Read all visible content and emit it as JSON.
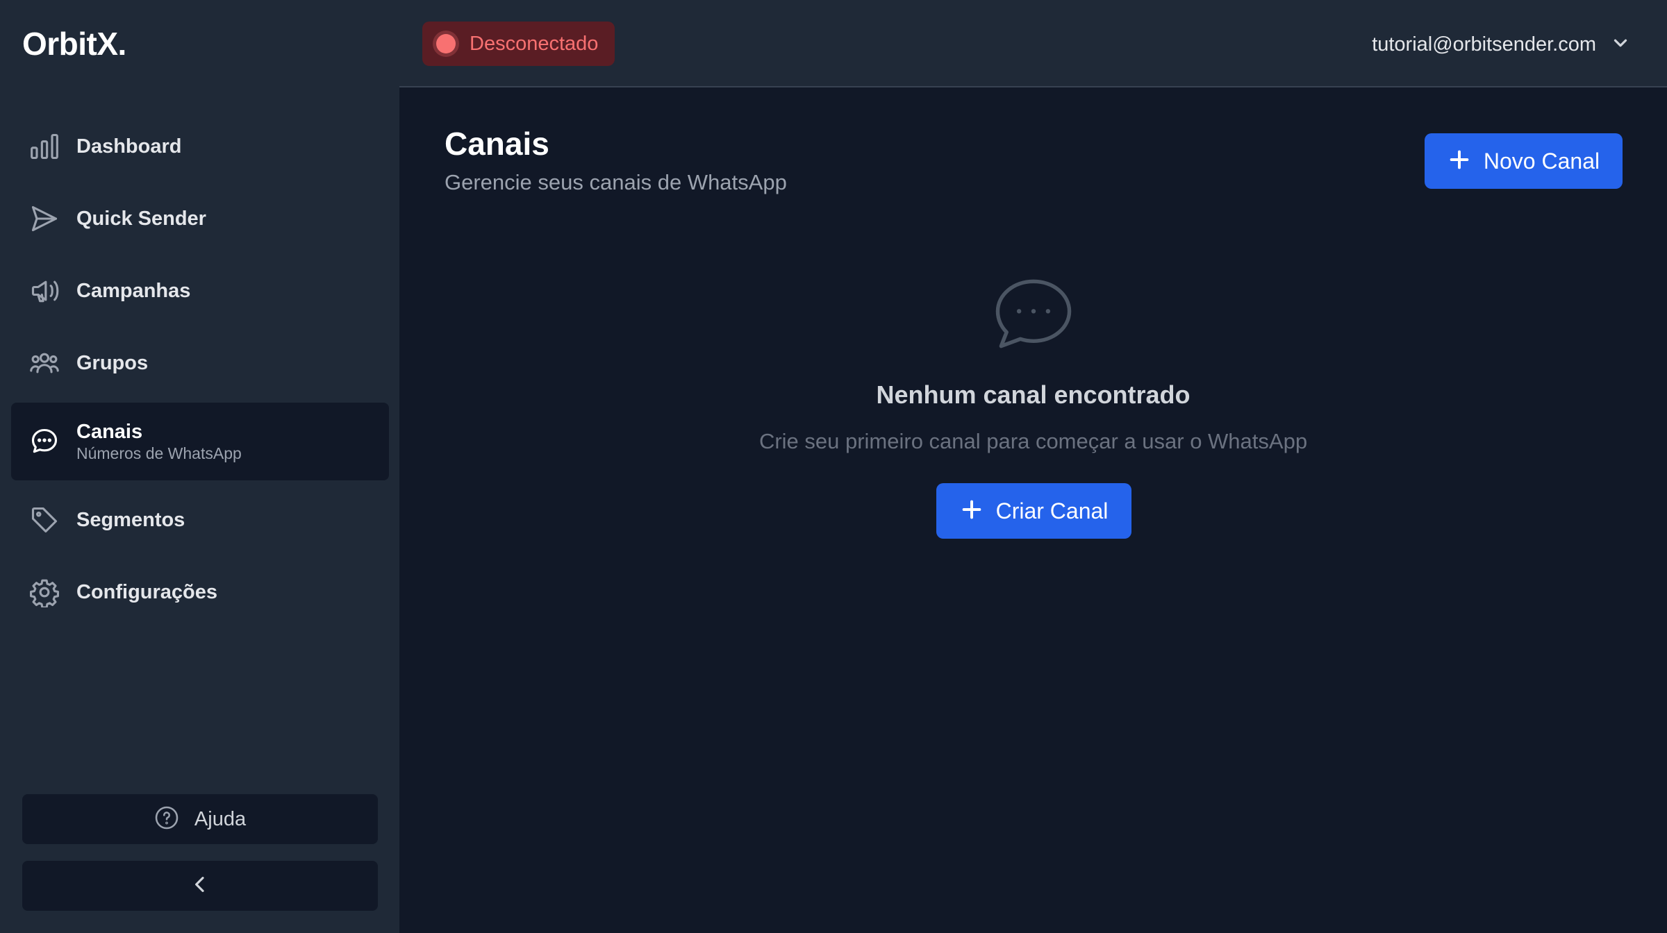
{
  "app": {
    "logo": "OrbitX."
  },
  "sidebar": {
    "items": [
      {
        "label": "Dashboard",
        "icon": "bar-chart-icon"
      },
      {
        "label": "Quick Sender",
        "icon": "send-icon"
      },
      {
        "label": "Campanhas",
        "icon": "megaphone-icon"
      },
      {
        "label": "Grupos",
        "icon": "users-icon"
      },
      {
        "label": "Canais",
        "sublabel": "Números de WhatsApp",
        "icon": "chat-bubble-icon",
        "active": true
      },
      {
        "label": "Segmentos",
        "icon": "tag-icon"
      },
      {
        "label": "Configurações",
        "icon": "gear-icon"
      }
    ],
    "help_label": "Ajuda",
    "collapse_icon": "chevron-left-icon"
  },
  "header": {
    "status": {
      "text": "Desconectado",
      "color": "#f87171"
    },
    "user_email": "tutorial@orbitsender.com"
  },
  "main": {
    "title": "Canais",
    "subtitle": "Gerencie seus canais de WhatsApp",
    "new_button_label": "Novo Canal",
    "empty_state": {
      "icon": "chat-bubble-icon",
      "title": "Nenhum canal encontrado",
      "description": "Crie seu primeiro canal para começar a usar o WhatsApp",
      "button_label": "Criar Canal"
    }
  },
  "colors": {
    "accent": "#2563eb",
    "sidebar_bg": "#1f2937",
    "main_bg": "#111827"
  }
}
